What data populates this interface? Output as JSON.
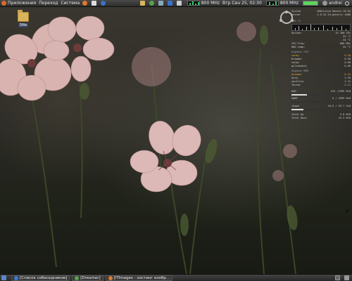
{
  "top_panel": {
    "menus": [
      "Приложения",
      "Переход",
      "Система"
    ],
    "cpu_freq1": "800 MHz",
    "datetime": "Втр Сен 25, 02:30",
    "cpu_freq2": "800 MHz",
    "username": "andrei"
  },
  "desktop": {
    "icon_label": "Sfile"
  },
  "conky": {
    "header_lines": [
      {
        "label": "System",
        "value": "GNU/Linux Ubuntu 10.04"
      },
      {
        "label": "Kernel",
        "value": "2.6.32-24-generic i686"
      }
    ],
    "cpu_label": "CPU 7%",
    "uptime": {
      "label": "Uptime:",
      "value": "1h 18m 25s"
    },
    "temps": [
      {
        "label": "",
        "value": "33 °C"
      },
      {
        "label": "",
        "value": "34 °C"
      }
    ],
    "cpu_freq": {
      "label": "CPU Freq:",
      "value": "800 MHz"
    },
    "hdd_temp": {
      "label": "HDD temp:",
      "value": "34 °C"
    },
    "highest_cpu_header": "Highest CPU",
    "top_cpu": [
      {
        "name": "conky",
        "value": "0.50"
      },
      {
        "name": "Dreamer",
        "value": "0.50"
      },
      {
        "name": "conky",
        "value": "0.00"
      },
      {
        "name": "pulseaudio",
        "value": "0.00"
      }
    ],
    "highest_mem_header": "Highest MEM",
    "top_mem": [
      {
        "name": "Dreamer",
        "value": "6.25"
      },
      {
        "name": "Xorg",
        "value": "3.39"
      },
      {
        "name": "nautilus",
        "value": "2.31"
      },
      {
        "name": "Thunar",
        "value": "2.11"
      }
    ],
    "ram": {
      "label": "RAM",
      "value": "515 /1999 MiB",
      "fraction": 0.26
    },
    "swap": {
      "label": "SWAP",
      "value": "0 / 5999 MiB",
      "fraction": 0.0
    },
    "disk": {
      "label": "/home",
      "value": "18.6 / 93.7 GiB",
      "fraction": 0.2
    },
    "net_up": {
      "label": "Total Up",
      "value": "3.8 MiB"
    },
    "net_down": {
      "label": "Total Down",
      "value": "43.3 MiB"
    }
  },
  "taskbar": {
    "tasks": [
      {
        "label": "[Список собеседников]",
        "color": "#3a7bd5"
      },
      {
        "label": "[Dreamer]",
        "color": "#58a24a"
      },
      {
        "label": "[ITImages - хостинг изобр...",
        "color": "#e07b2a"
      }
    ]
  }
}
